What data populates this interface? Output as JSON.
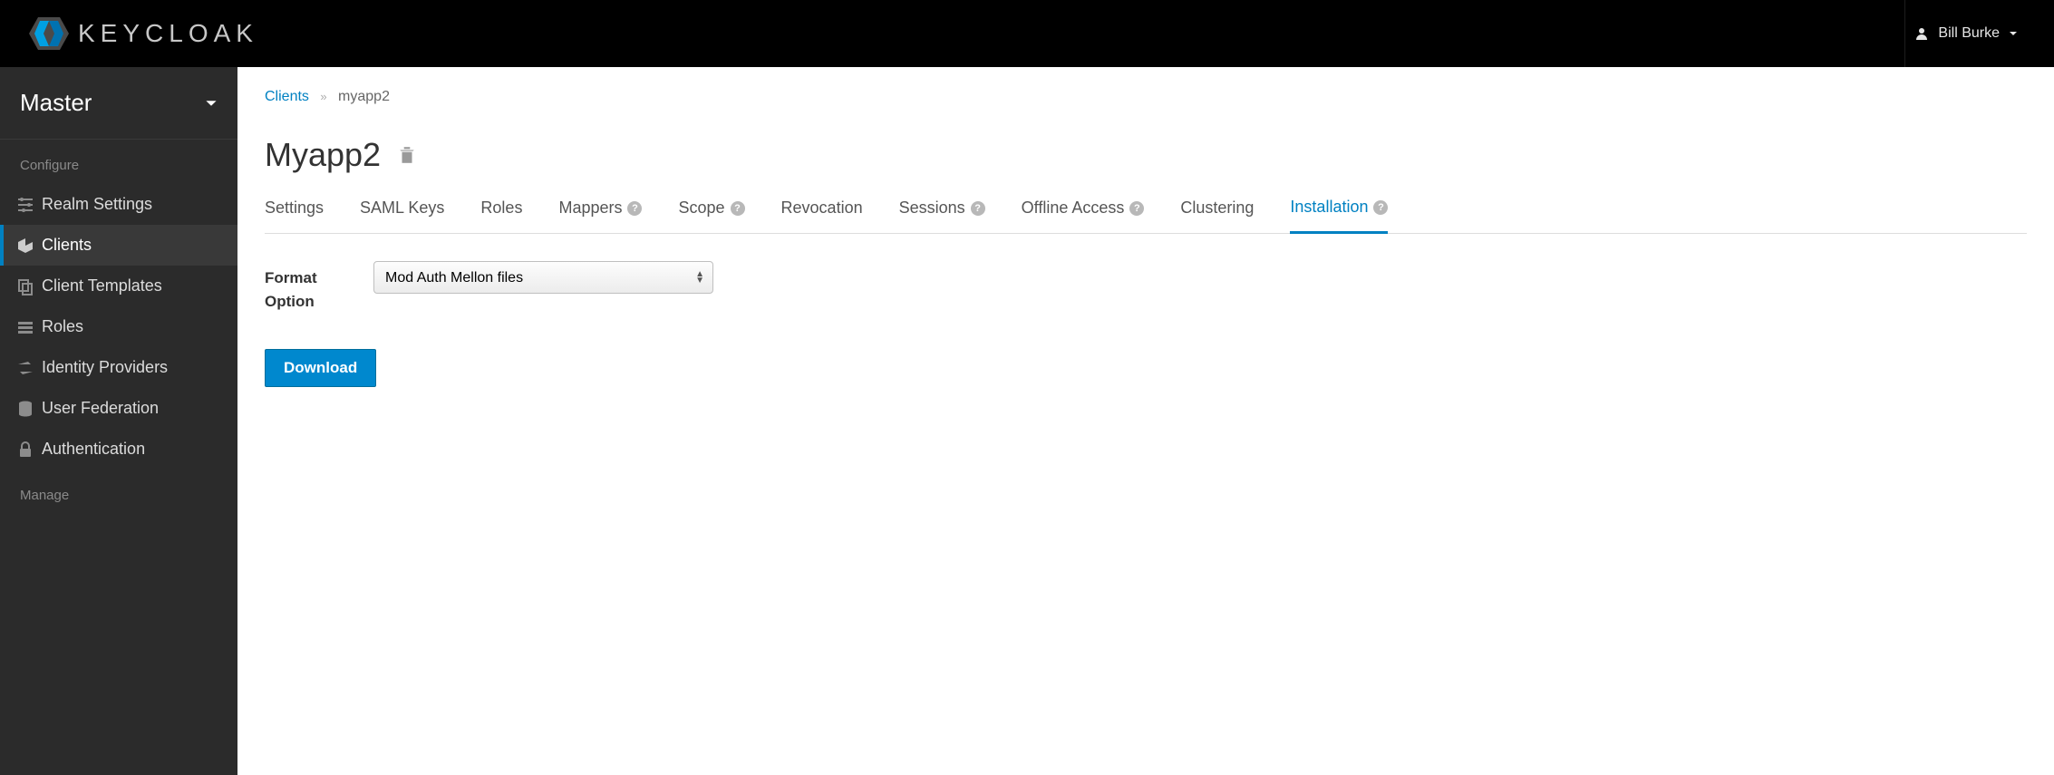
{
  "header": {
    "brand": "KEYCLOAK",
    "user_name": "Bill Burke"
  },
  "sidebar": {
    "realm": "Master",
    "sections": [
      {
        "label": "Configure",
        "items": [
          {
            "key": "realm-settings",
            "label": "Realm Settings",
            "icon": "sliders"
          },
          {
            "key": "clients",
            "label": "Clients",
            "icon": "cube",
            "active": true
          },
          {
            "key": "client-templates",
            "label": "Client Templates",
            "icon": "copy"
          },
          {
            "key": "roles",
            "label": "Roles",
            "icon": "list"
          },
          {
            "key": "identity-providers",
            "label": "Identity Providers",
            "icon": "exchange"
          },
          {
            "key": "user-federation",
            "label": "User Federation",
            "icon": "database"
          },
          {
            "key": "authentication",
            "label": "Authentication",
            "icon": "lock"
          }
        ]
      },
      {
        "label": "Manage",
        "items": []
      }
    ]
  },
  "breadcrumbs": {
    "parent": "Clients",
    "current": "myapp2"
  },
  "page": {
    "title": "Myapp2",
    "tabs": [
      {
        "key": "settings",
        "label": "Settings"
      },
      {
        "key": "saml-keys",
        "label": "SAML Keys"
      },
      {
        "key": "roles",
        "label": "Roles"
      },
      {
        "key": "mappers",
        "label": "Mappers",
        "help": true
      },
      {
        "key": "scope",
        "label": "Scope",
        "help": true
      },
      {
        "key": "revocation",
        "label": "Revocation"
      },
      {
        "key": "sessions",
        "label": "Sessions",
        "help": true
      },
      {
        "key": "offline-access",
        "label": "Offline Access",
        "help": true
      },
      {
        "key": "clustering",
        "label": "Clustering"
      },
      {
        "key": "installation",
        "label": "Installation",
        "help": true,
        "active": true
      }
    ],
    "form": {
      "format_label": "Format Option",
      "format_selected": "Mod Auth Mellon files",
      "download_label": "Download"
    }
  }
}
